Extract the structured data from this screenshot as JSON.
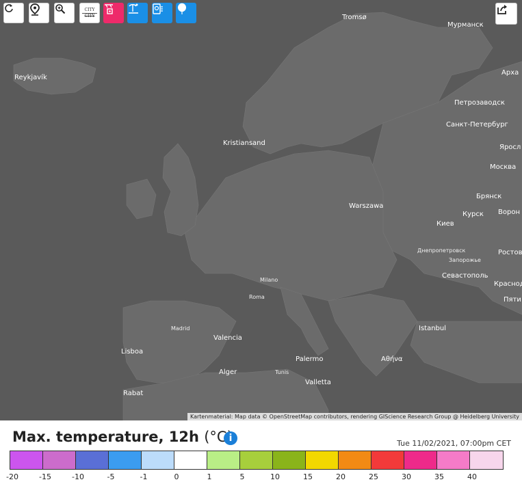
{
  "toolbar": {
    "refresh_icon": "refresh-icon",
    "location_icon": "map-pin-icon",
    "zoom_icon": "zoom-search-icon",
    "city_label": "CITY",
    "city_sub_label": "CITY",
    "wind_icon": "wind-marker-icon",
    "beach_icon": "beach-icon",
    "station_icon": "station-icon",
    "balloon_icon": "balloon-icon",
    "share_icon": "share-icon",
    "colors": {
      "pink": "#ee2a6a",
      "blue": "#1a8fe6"
    }
  },
  "map": {
    "places": [
      {
        "name": "Reykjavík"
      },
      {
        "name": "Tromsø"
      },
      {
        "name": "Мурманск"
      },
      {
        "name": "Арха"
      },
      {
        "name": "Петрозаводск"
      },
      {
        "name": "Санкт-Петербург"
      },
      {
        "name": "Яросл"
      },
      {
        "name": "Москва"
      },
      {
        "name": "Брянск"
      },
      {
        "name": "Курск"
      },
      {
        "name": "Ворон"
      },
      {
        "name": "Ростов"
      },
      {
        "name": "Краснод"
      },
      {
        "name": "Пяти"
      },
      {
        "name": "Kristiansand"
      },
      {
        "name": "Warszawa"
      },
      {
        "name": "Киев"
      },
      {
        "name": "Днепропетровск"
      },
      {
        "name": "Запорожье"
      },
      {
        "name": "Севастополь"
      },
      {
        "name": "Istanbul"
      },
      {
        "name": "Αθήνα"
      },
      {
        "name": "Valencia"
      },
      {
        "name": "Palermo"
      },
      {
        "name": "Valletta"
      },
      {
        "name": "Alger"
      },
      {
        "name": "Tunis"
      },
      {
        "name": "Rabat"
      },
      {
        "name": "Lisboa"
      },
      {
        "name": "Madrid"
      },
      {
        "name": "Milano"
      },
      {
        "name": "Roma"
      }
    ],
    "attribution": "Kartenmaterial: Map data © OpenStreetMap contributors, rendering GIScience Research Group @ Heidelberg University"
  },
  "legend": {
    "title": "Max. temperature, 12h",
    "unit": "(°C)",
    "info_icon": "info-icon",
    "timestamp": "Tue 11/02/2021, 07:00pm CET",
    "ticks": [
      "-20",
      "-15",
      "-10",
      "-5",
      "-1",
      "0",
      "1",
      "5",
      "10",
      "15",
      "20",
      "25",
      "30",
      "35",
      "40"
    ],
    "colors": [
      "#cc55ee",
      "#cc6ccc",
      "#5a6fd6",
      "#3b9cf0",
      "#bcdcfb",
      "#ffffff",
      "#b9ee86",
      "#a7cf3c",
      "#8ab41a",
      "#f2d800",
      "#f28a14",
      "#f23a3a",
      "#ee2a8a",
      "#f57bc8",
      "#f7d6ec"
    ]
  }
}
